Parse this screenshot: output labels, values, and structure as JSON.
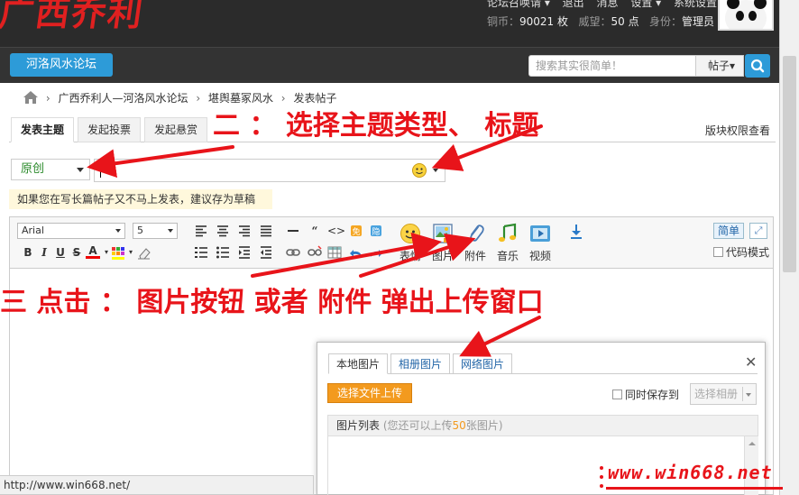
{
  "header": {
    "logo_text": "广西乔利",
    "user_links": [
      "论坛召唤请 ▾",
      "退出",
      "消息",
      "设置 ▾",
      "系统设置"
    ],
    "stats": {
      "coin_label": "铜币：",
      "coin_value": "90021 枚",
      "rep_label": "威望：",
      "rep_value": "50 点",
      "role_label": "身份：",
      "role_value": "管理员"
    }
  },
  "nav": {
    "forum_button": "河洛风水论坛",
    "search_placeholder": "搜索其实很简单！",
    "search_type": "帖子▾"
  },
  "breadcrumb": [
    "广西乔利人—河洛风水论坛",
    "堪舆墓冢风水",
    "发表帖子"
  ],
  "tabs": [
    "发表主题",
    "发起投票",
    "发起悬赏"
  ],
  "perm_link": "版块权限查看",
  "post": {
    "type_value": "原创",
    "tip": "如果您在写长篇帖子又不马上发表，建议存为草稿"
  },
  "toolbar": {
    "font_name": "Arial",
    "font_size": "5",
    "media_buttons": [
      "表情",
      "图片",
      "附件",
      "音乐",
      "视频"
    ],
    "simple_label": "简单",
    "code_mode": "代码模式"
  },
  "dialog": {
    "tabs": [
      "本地图片",
      "相册图片",
      "网络图片"
    ],
    "upload_button": "选择文件上传",
    "save_to": "同时保存到",
    "album_placeholder": "选择相册",
    "list_title": "图片列表",
    "list_note_before": "(您还可以上传",
    "list_note_num": "50",
    "list_note_after": "张图片)"
  },
  "annotations": {
    "step2": "二 ： 选择主题类型、 标题",
    "step3": "三  点击 ： 图片按钮 或者 附件  弹出上传窗口"
  },
  "statusbar_url": "http://www.win668.net/",
  "watermark": "www.win668.net",
  "colors": {
    "header_bg": "#2b2b2b",
    "accent_blue": "#2d9bd8",
    "annotation_red": "#e8141a",
    "upload_orange": "#f39a1e"
  }
}
